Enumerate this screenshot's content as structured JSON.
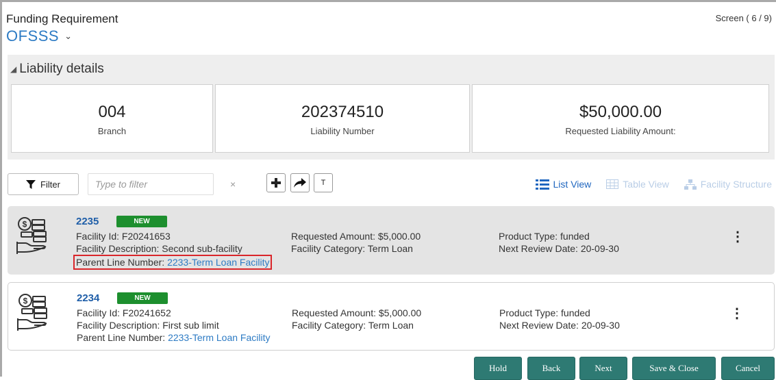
{
  "header": {
    "title": "Funding Requirement",
    "app_name": "OFSSS",
    "screen_indicator": "Screen ( 6 / 9)"
  },
  "liability": {
    "section_title": "Liability details",
    "cards": [
      {
        "value": "004",
        "label": "Branch"
      },
      {
        "value": "202374510",
        "label": "Liability Number"
      },
      {
        "value": "$50,000.00",
        "label": "Requested Liability Amount:"
      }
    ]
  },
  "toolbar": {
    "filter_label": "Filter",
    "filter_placeholder": "Type to filter",
    "clear": "×",
    "text_button": "T",
    "views": {
      "list": "List View",
      "table": "Table View",
      "structure": "Facility Structure"
    }
  },
  "facilities": [
    {
      "id": "2235",
      "badge": "NEW",
      "facility_id": "Facility Id: F20241653",
      "description": "Facility Description: Second sub-facility",
      "parent_prefix": "Parent Line Number: ",
      "parent_link": "2233-Term Loan Facility",
      "requested_amount": "Requested Amount: $5,000.00",
      "category": "Facility Category: Term Loan",
      "product_type": "Product Type: funded",
      "review_date": "Next Review Date: 20-09-30"
    },
    {
      "id": "2234",
      "badge": "NEW",
      "facility_id": "Facility Id: F20241652",
      "description": "Facility Description: First sub limit",
      "parent_prefix": "Parent Line Number: ",
      "parent_link": "2233-Term Loan Facility",
      "requested_amount": "Requested Amount: $5,000.00",
      "category": "Facility Category: Term Loan",
      "product_type": "Product Type: funded",
      "review_date": "Next Review Date: 20-09-30"
    }
  ],
  "footer": {
    "hold": "Hold",
    "back": "Back",
    "next": "Next",
    "save_close": "Save & Close",
    "cancel": "Cancel"
  },
  "colors": {
    "accent": "#2d7bc4",
    "badge": "#1d8f2e",
    "footer_button": "#2e7a73",
    "highlight_box": "#d9252a"
  }
}
